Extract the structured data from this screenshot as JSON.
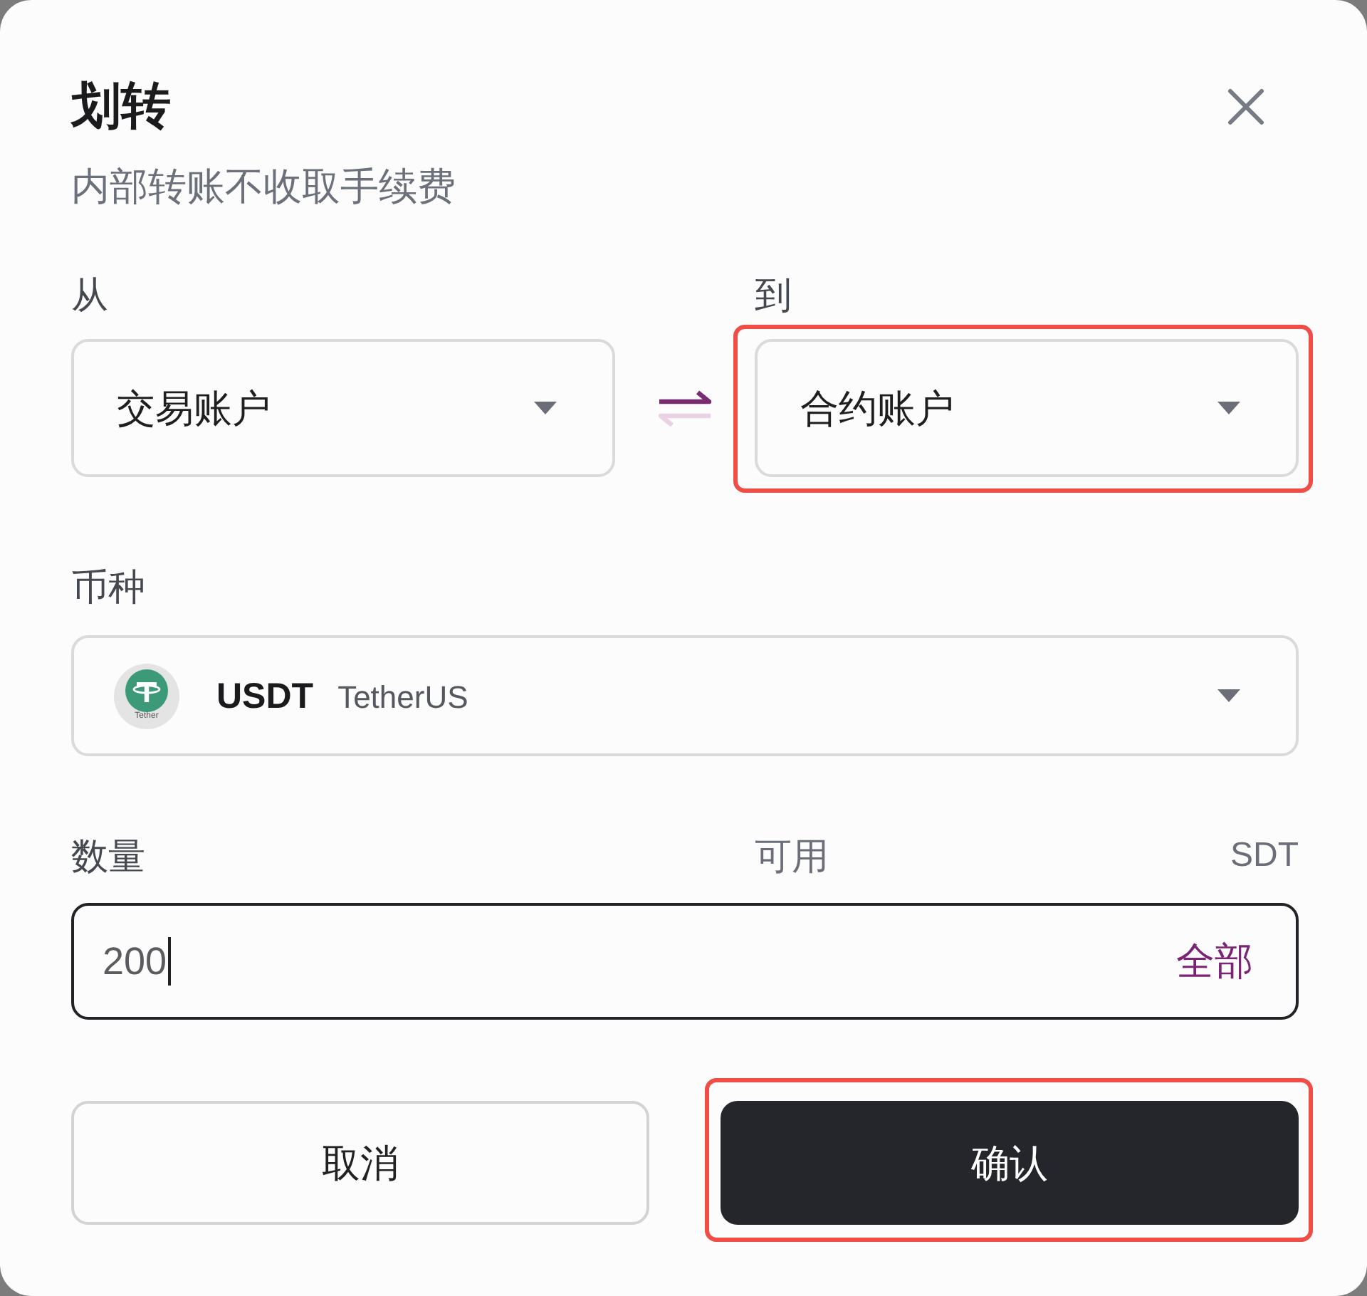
{
  "dialog": {
    "title": "划转",
    "subtitle": "内部转账不收取手续费"
  },
  "accounts": [
    {
      "label": "从",
      "value": "交易账户",
      "highlighted": false
    },
    {
      "label": "到",
      "value": "合约账户",
      "highlighted": true
    }
  ],
  "coin": {
    "label": "币种",
    "symbol": "USDT",
    "name": "TetherUS",
    "logo_caption": "Tether"
  },
  "amount": {
    "label": "数量",
    "available_label": "可用",
    "available_tail": "SDT",
    "value": "200",
    "focused": true,
    "max_button": "全部"
  },
  "buttons": [
    {
      "kind": "secondary",
      "label": "取消",
      "highlighted": false
    },
    {
      "kind": "primary",
      "label": "确认",
      "highlighted": true
    }
  ]
}
